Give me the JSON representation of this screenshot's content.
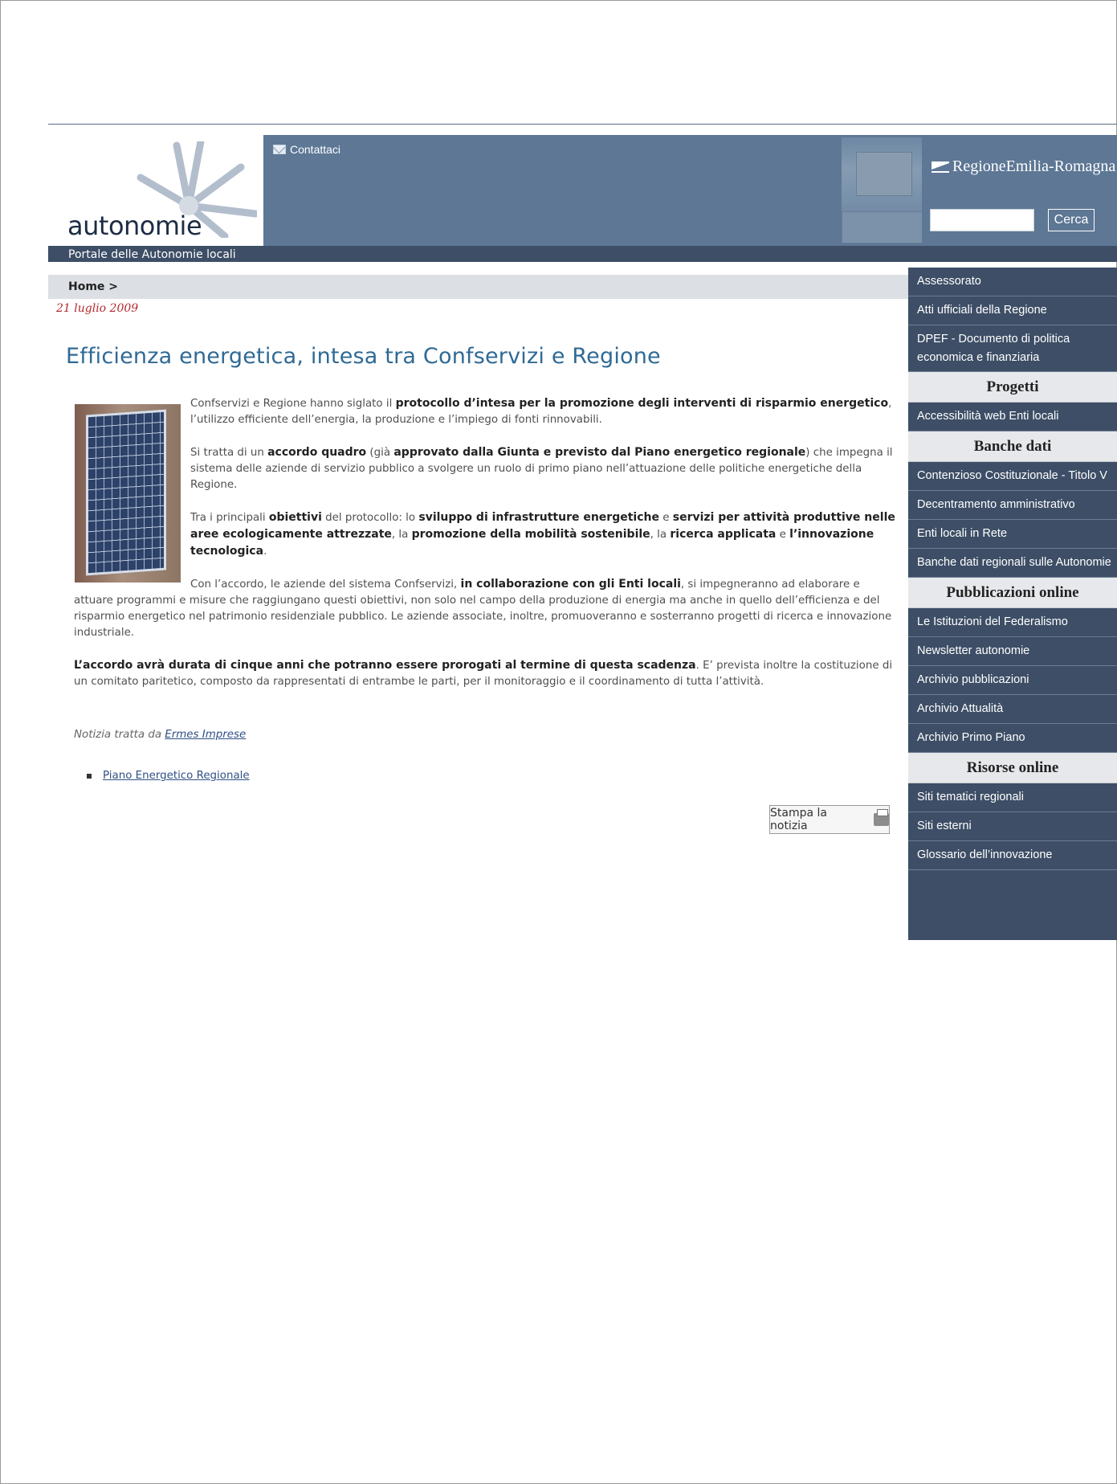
{
  "header": {
    "logo_text": "autonomie",
    "contact_label": "Contattaci",
    "region_logo": "RegioneEmilia-Romagna",
    "search": {
      "value": "",
      "button_label": "Cerca"
    },
    "portal_label": "Portale delle Autonomie locali"
  },
  "breadcrumb": "Home >",
  "date": "21 luglio 2009",
  "article": {
    "title": "Efficienza energetica, intesa tra Confservizi e Regione",
    "p1": [
      {
        "t": "Confservizi e Regione hanno siglato il ",
        "b": false
      },
      {
        "t": "protocollo d’intesa per la promozione degli interventi di risparmio energetico",
        "b": true
      },
      {
        "t": ", l’utilizzo efficiente dell’energia, la produzione e l’impiego di fonti rinnovabili.",
        "b": false
      }
    ],
    "p2": [
      {
        "t": "Si tratta di un ",
        "b": false
      },
      {
        "t": "accordo quadro",
        "b": true
      },
      {
        "t": " (già ",
        "b": false
      },
      {
        "t": "approvato dalla Giunta e previsto dal Piano energetico regionale",
        "b": true
      },
      {
        "t": ") che impegna il sistema delle aziende di servizio pubblico a svolgere un ruolo di primo piano nell’attuazione delle politiche energetiche della Regione.",
        "b": false
      }
    ],
    "p3": [
      {
        "t": "Tra i principali ",
        "b": false
      },
      {
        "t": "obiettivi",
        "b": true
      },
      {
        "t": " del protocollo: lo ",
        "b": false
      },
      {
        "t": "sviluppo di infrastrutture energetiche",
        "b": true
      },
      {
        "t": " e ",
        "b": false
      },
      {
        "t": "servizi per attività produttive nelle aree ecologicamente attrezzate",
        "b": true
      },
      {
        "t": ", la ",
        "b": false
      },
      {
        "t": "promozione della mobilità sostenibile",
        "b": true
      },
      {
        "t": ", la ",
        "b": false
      },
      {
        "t": "ricerca applicata",
        "b": true
      },
      {
        "t": " e ",
        "b": false
      },
      {
        "t": "l’innovazione tecnologica",
        "b": true
      },
      {
        "t": ".",
        "b": false
      }
    ],
    "p4": [
      {
        "t": "Con l’accordo, le aziende del sistema Confservizi, ",
        "b": false
      },
      {
        "t": "in collaborazione con gli Enti locali",
        "b": true
      },
      {
        "t": ", si impegneranno ad elaborare e attuare programmi e misure che raggiungano questi obiettivi, non solo nel campo della produzione di energia ma anche in quello dell’efficienza e del risparmio energetico nel patrimonio residenziale pubblico. Le aziende associate, inoltre, promuoveranno e sosterranno progetti di ricerca e innovazione industriale.",
        "b": false
      }
    ],
    "p5": [
      {
        "t": "L’accordo avrà durata di cinque anni che potranno essere prorogati al termine di questa scadenza",
        "b": true
      },
      {
        "t": ". E’ prevista inoltre la costituzione di un comitato paritetico, composto da rappresentati di entrambe le parti, per il monitoraggio e il coordinamento di tutta l’attività.",
        "b": false
      }
    ],
    "note_prefix": "Notizia tratta da ",
    "note_link": "Ermes Imprese",
    "bullet_link": "Piano Energetico Regionale ",
    "print_label": "Stampa la notizia"
  },
  "sidebar": {
    "items_top": [
      "Assessorato",
      "Atti ufficiali della Regione"
    ],
    "dpef": [
      "DPEF - Documento di politica",
      "economica e finanziaria"
    ],
    "progetti_head": "Progetti",
    "progetti": [
      "Accessibilità web Enti locali"
    ],
    "banche_head": "Banche dati",
    "banche": [
      "Contenzioso Costituzionale - Titolo V",
      "Decentramento amministrativo",
      "Enti locali in Rete",
      "Banche dati regionali sulle Autonomie"
    ],
    "pubblicazioni_head": "Pubblicazioni online",
    "pubblicazioni": [
      "Le Istituzioni del Federalismo",
      "Newsletter autonomie",
      "Archivio pubblicazioni",
      "Archivio Attualità",
      "Archivio Primo Piano"
    ],
    "risorse_head": "Risorse online",
    "risorse": [
      "Siti tematici regionali",
      "Siti esterni",
      "Glossario dell’innovazione"
    ]
  },
  "colors": {
    "header_blue": "#5d7795",
    "sidebar_navy": "#3d4e66",
    "title_blue": "#2f6a95",
    "date_red": "#b3282d"
  },
  "icons": [
    "mail-icon",
    "flag-icon",
    "printer-icon"
  ]
}
